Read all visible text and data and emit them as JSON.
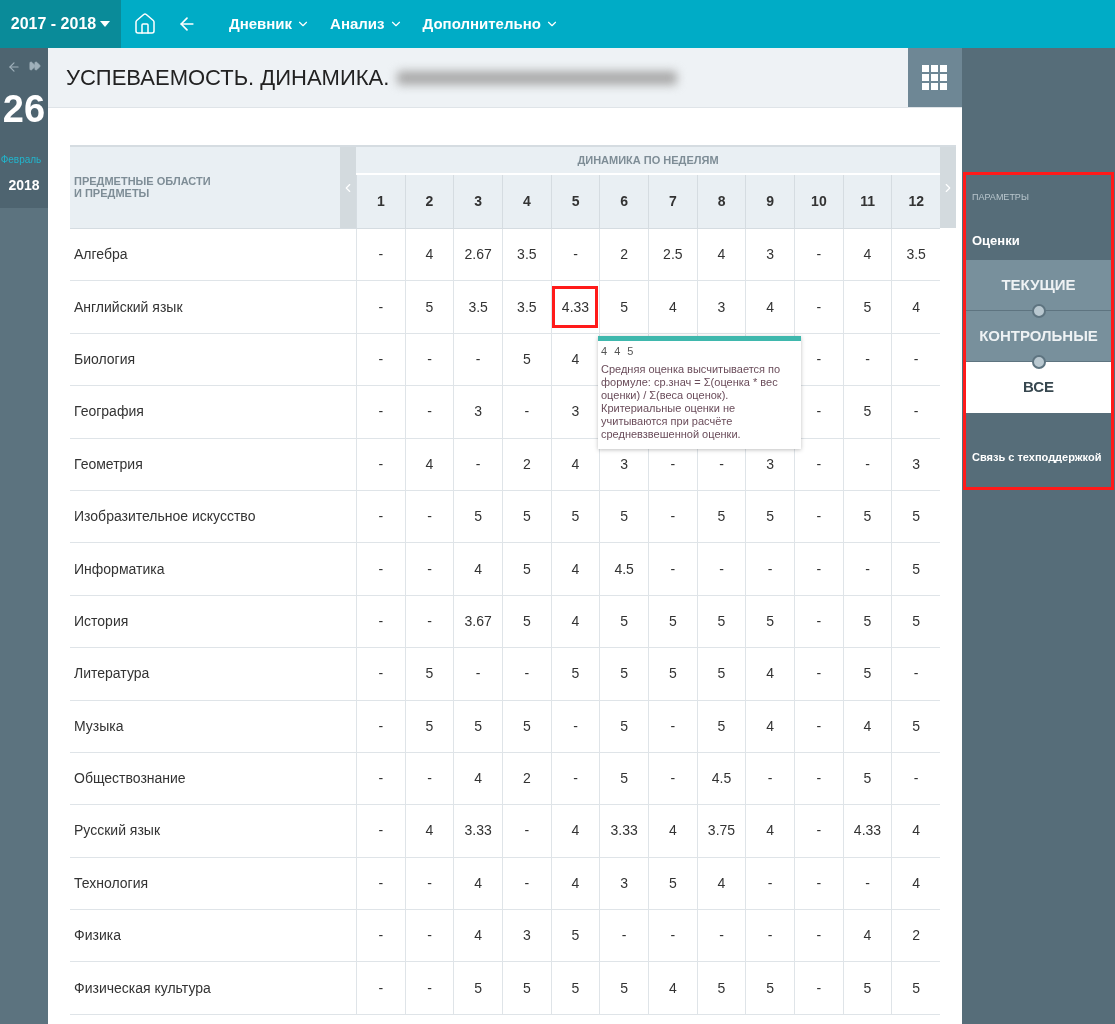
{
  "nav": {
    "year": "2017 - 2018",
    "menu": [
      {
        "label": "Дневник"
      },
      {
        "label": "Анализ"
      },
      {
        "label": "Дополнительно"
      }
    ]
  },
  "date_panel": {
    "day": "26",
    "month": "Февраль",
    "year": "2018"
  },
  "page_title": "УСПЕВАЕМОСТЬ. ДИНАМИКА.",
  "table": {
    "subject_header": "ПРЕДМЕТНЫЕ ОБЛАСТИ\nИ ПРЕДМЕТЫ",
    "group_header": "ДИНАМИКА ПО НЕДЕЛЯМ",
    "weeks": [
      "1",
      "2",
      "3",
      "4",
      "5",
      "6",
      "7",
      "8",
      "9",
      "10",
      "11",
      "12"
    ],
    "rows": [
      {
        "subject": "Алгебра",
        "values": [
          "-",
          "4",
          "2.67",
          "3.5",
          "-",
          "2",
          "2.5",
          "4",
          "3",
          "-",
          "4",
          "3.5"
        ]
      },
      {
        "subject": "Английский язык",
        "values": [
          "-",
          "5",
          "3.5",
          "3.5",
          {
            "text": "4.33",
            "marked": true
          },
          "5",
          "4",
          "3",
          "4",
          "-",
          "5",
          "4"
        ]
      },
      {
        "subject": "Биология",
        "values": [
          "-",
          "-",
          "-",
          "5",
          "4"
        ],
        "values_after_tooltip": [
          "-",
          "-",
          "-"
        ]
      },
      {
        "subject": "География",
        "values": [
          "-",
          "-",
          "3",
          "-",
          "3"
        ],
        "values_after_tooltip": [
          "-",
          "5",
          "-"
        ]
      },
      {
        "subject": "Геометрия",
        "values": [
          "-",
          "4",
          "-",
          "2",
          "4",
          "3",
          "-",
          "-",
          "3",
          "-",
          "-",
          "3"
        ]
      },
      {
        "subject": "Изобразительное искусство",
        "values": [
          "-",
          "-",
          "5",
          "5",
          "5",
          "5",
          "-",
          "5",
          "5",
          "-",
          "5",
          "5"
        ]
      },
      {
        "subject": "Информатика",
        "values": [
          "-",
          "-",
          "4",
          "5",
          "4",
          "4.5",
          "-",
          "-",
          "-",
          "-",
          "-",
          "5"
        ]
      },
      {
        "subject": "История",
        "values": [
          "-",
          "-",
          "3.67",
          "5",
          "4",
          "5",
          "5",
          "5",
          "5",
          "-",
          "5",
          "5"
        ]
      },
      {
        "subject": "Литература",
        "values": [
          "-",
          "5",
          "-",
          "-",
          "5",
          "5",
          "5",
          "5",
          "4",
          "-",
          "5",
          "-"
        ]
      },
      {
        "subject": "Музыка",
        "values": [
          "-",
          "5",
          "5",
          "5",
          "-",
          "5",
          "-",
          "5",
          "4",
          "-",
          "4",
          "5"
        ]
      },
      {
        "subject": "Обществознание",
        "values": [
          "-",
          "-",
          "4",
          "2",
          "-",
          "5",
          "-",
          "4.5",
          "-",
          "-",
          "5",
          "-"
        ]
      },
      {
        "subject": "Русский язык",
        "values": [
          "-",
          "4",
          "3.33",
          "-",
          "4",
          "3.33",
          "4",
          "3.75",
          "4",
          "-",
          "4.33",
          "4"
        ]
      },
      {
        "subject": "Технология",
        "values": [
          "-",
          "-",
          "4",
          "-",
          "4",
          "3",
          "5",
          "4",
          "-",
          "-",
          "-",
          "4"
        ]
      },
      {
        "subject": "Физика",
        "values": [
          "-",
          "-",
          "4",
          "3",
          "5",
          "-",
          "-",
          "-",
          "-",
          "-",
          "4",
          "2"
        ]
      },
      {
        "subject": "Физическая культура",
        "values": [
          "-",
          "-",
          "5",
          "5",
          "5",
          "5",
          "4",
          "5",
          "5",
          "-",
          "5",
          "5"
        ]
      }
    ]
  },
  "tooltip": {
    "marks": "4 4 5",
    "text": "Средняя оценка высчитывается по формуле: ср.знач = Σ(оценка * вес оценки) / Σ(веса оценок). Критериальные оценки не учитываются при расчёте средневзвешенной оценки."
  },
  "params": {
    "marked": true,
    "heading": "ПАРАМЕТРЫ",
    "label": "Оценки",
    "options": [
      {
        "label": "ТЕКУЩИЕ",
        "selected": false
      },
      {
        "label": "КОНТРОЛЬНЫЕ",
        "selected": false
      },
      {
        "label": "ВСЕ",
        "selected": true
      }
    ],
    "support_link": "Связь с техподдержкой"
  }
}
